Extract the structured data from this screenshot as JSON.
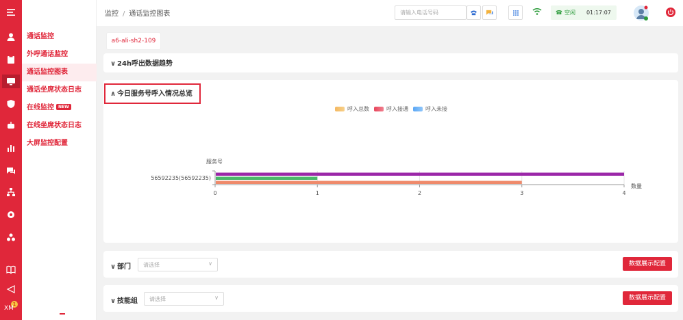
{
  "rail": {
    "icons": [
      "menu-icon",
      "user-icon",
      "clipboard-icon",
      "monitor-icon",
      "shield-icon",
      "robot-icon",
      "bar-chart-icon",
      "chat-icon",
      "org-icon",
      "gear-icon",
      "cluster-icon",
      "book-icon",
      "send-icon"
    ],
    "user_initials": "XM",
    "badge_count": "1"
  },
  "submenu": {
    "items": [
      {
        "label": "通话监控"
      },
      {
        "label": "外呼通话监控"
      },
      {
        "label": "通话监控图表"
      },
      {
        "label": "通话坐席状态日志"
      },
      {
        "label": "在线监控",
        "badge": "NEW"
      },
      {
        "label": "在线坐席状态日志"
      },
      {
        "label": "大屏监控配置"
      }
    ],
    "active_index": 2
  },
  "topbar": {
    "breadcrumb": [
      "监控",
      "通话监控图表"
    ],
    "breadcrumb_sep": "/",
    "search_placeholder": "请输入电话号码",
    "status_text": "空闲",
    "timer": "01:17:07"
  },
  "server_tag": "a6-ali-sh2-109",
  "sections": {
    "trend_title": "24h呼出数据趋势",
    "summary_title": "今日服务号呼入情况总览",
    "department_label": "部门",
    "skill_group_label": "技能组",
    "select_placeholder": "请选择",
    "config_button": "数据展示配置"
  },
  "colors": {
    "brand": "#e0273a"
  },
  "chart_data": {
    "type": "bar",
    "orientation": "horizontal",
    "categories": [
      "56592235(56592235)"
    ],
    "series": [
      {
        "name": "呼入总数",
        "values": [
          4
        ],
        "color": "#9b27a8"
      },
      {
        "name": "呼入接通",
        "values": [
          1
        ],
        "color": "#4bb86b"
      },
      {
        "name": "呼入未接",
        "values": [
          3
        ],
        "color": "#ef8a6b"
      }
    ],
    "legend": [
      {
        "name": "呼入总数",
        "color": "#f4b860"
      },
      {
        "name": "呼入接通",
        "color": "#e8455a"
      },
      {
        "name": "呼入未接",
        "color": "#5aa7f5"
      }
    ],
    "xlabel": "数量",
    "ylabel": "服务号",
    "xlim": [
      0,
      4
    ],
    "xticks": [
      "0",
      "1",
      "2",
      "3",
      "4"
    ],
    "grid": true,
    "legend_position": "top-center"
  }
}
